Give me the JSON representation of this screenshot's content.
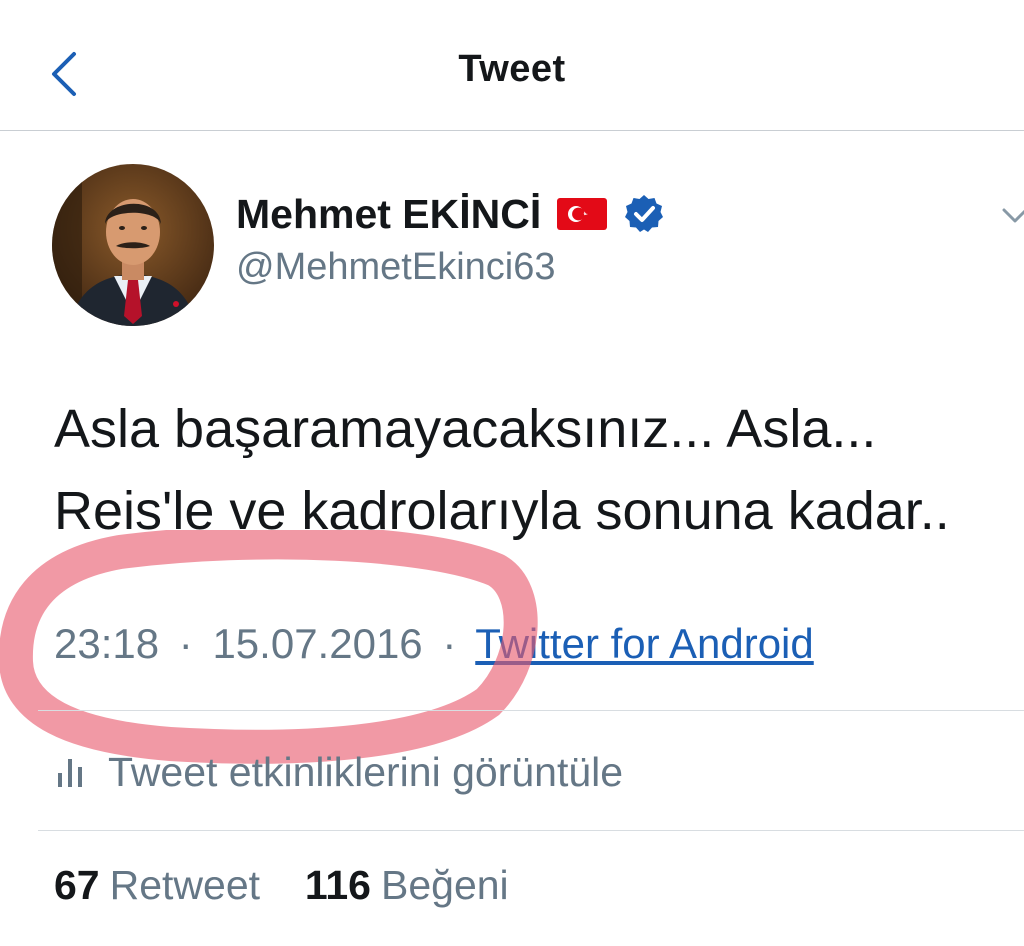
{
  "header": {
    "title": "Tweet",
    "back_icon": "chevron-left-icon"
  },
  "author": {
    "name": "Mehmet EKİNCİ",
    "handle": "@MehmetEkinci63",
    "flag_icon": "turkey-flag-icon",
    "verified_icon": "verified-badge-icon"
  },
  "tweet": {
    "lines": [
      "Asla başaramayacaksınız... Asla...",
      "Reis'le ve kadrolarıyla sonuna kadar.."
    ],
    "time": "23:18",
    "separator": "·",
    "date": "15.07.2016",
    "source": "Twitter for Android"
  },
  "analytics": {
    "label": "Tweet etkinliklerini görüntüle"
  },
  "stats": {
    "retweets": "67",
    "retweets_label": "Retweet",
    "likes": "116",
    "likes_label": "Beğeni"
  },
  "colors": {
    "accent": "#1b5fb5",
    "secondary_text": "#657786",
    "highlight": "#e85a6e"
  }
}
